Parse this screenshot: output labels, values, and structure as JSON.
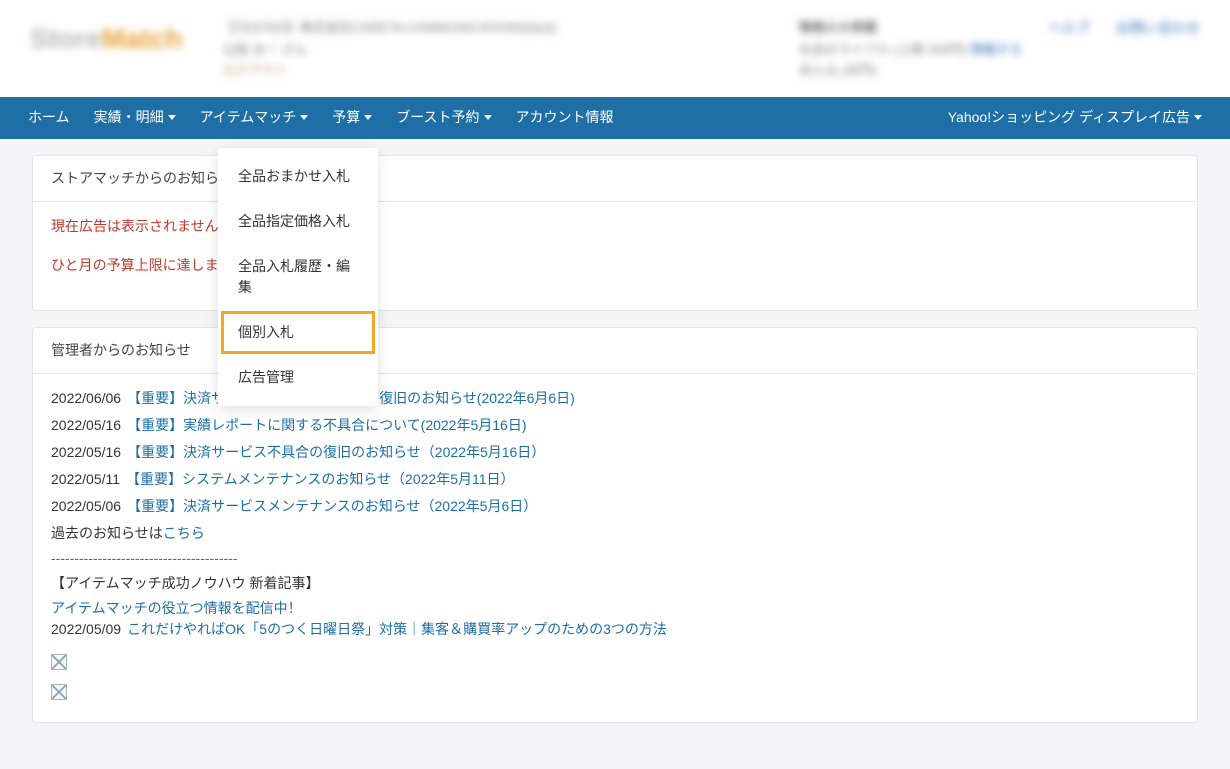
{
  "logo": {
    "text_a": "Store",
    "text_b": "Match"
  },
  "nav": {
    "items": [
      "ホーム",
      "実績・明細",
      "アイテムマッチ",
      "予算",
      "ブースト予約",
      "アカウント情報"
    ],
    "right": "Yahoo!ショッピング ディスプレイ広告"
  },
  "dropdown": {
    "items": [
      "全品おまかせ入札",
      "全品指定価格入札",
      "全品入札履歴・編集",
      "個別入札",
      "広告管理"
    ],
    "highlighted_index": 3
  },
  "panel_store": {
    "title": "ストアマッチからのお知らせ",
    "alert_lines": [
      "現在広告は表示されません",
      "ひと月の予算上限に達しま"
    ]
  },
  "panel_admin": {
    "title": "管理者からのお知らせ",
    "news": [
      {
        "date": "2022/06/06",
        "text": "【重要】決済サービス不具合のお詫びと復旧のお知らせ(2022年6月6日)"
      },
      {
        "date": "2022/05/16",
        "text": "【重要】実績レポートに関する不具合について(2022年5月16日)"
      },
      {
        "date": "2022/05/16",
        "text": "【重要】決済サービス不具合の復旧のお知らせ（2022年5月16日）"
      },
      {
        "date": "2022/05/11",
        "text": "【重要】システムメンテナンスのお知らせ（2022年5月11日）"
      },
      {
        "date": "2022/05/06",
        "text": "【重要】決済サービスメンテナンスのお知らせ（2022年5月6日）"
      }
    ],
    "past_prefix": "過去のお知らせは",
    "past_link": "こちら",
    "dashes": "----------------------------------------",
    "subhead": "【アイテムマッチ成功ノウハウ 新着記事】",
    "info_link": "アイテムマッチの役立つ情報を配信中！",
    "article": {
      "date": "2022/05/09",
      "text": "これだけやればOK「5のつく日曜日祭」対策｜集客＆購買率アップのための3つの方法"
    }
  }
}
